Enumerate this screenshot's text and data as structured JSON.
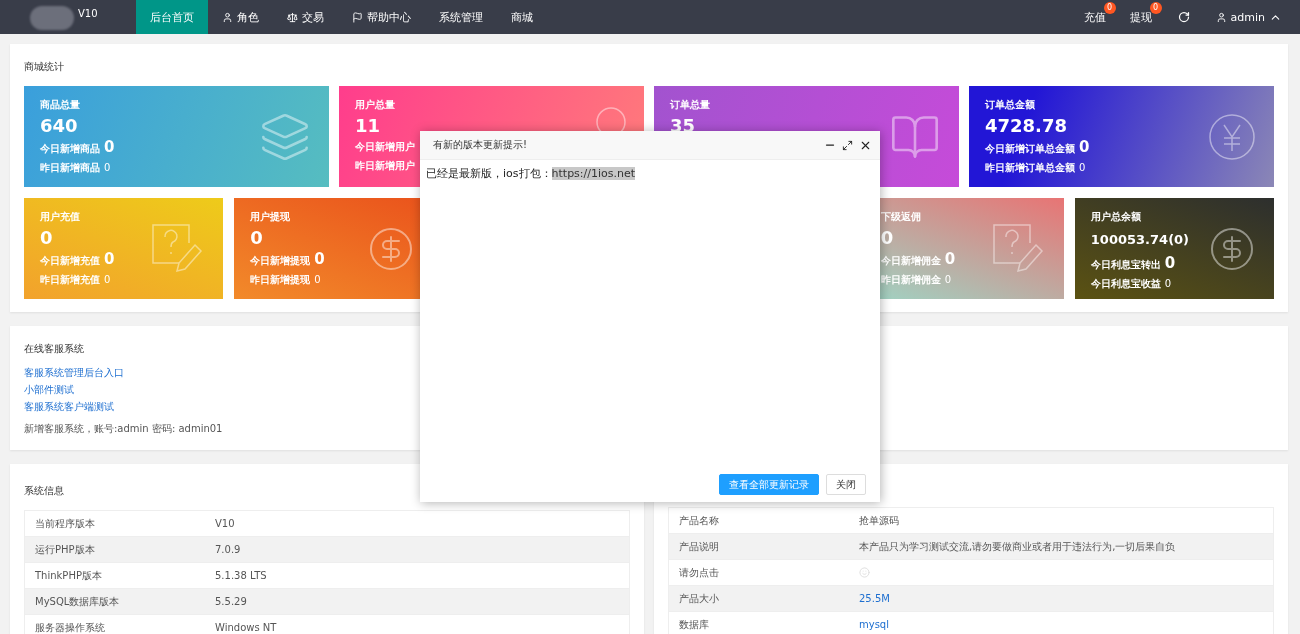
{
  "nav": {
    "version": "V10",
    "items": [
      {
        "label": "后台首页",
        "selected": true
      },
      {
        "label": "角色",
        "selected": false
      },
      {
        "label": "交易",
        "selected": false
      },
      {
        "label": "帮助中心",
        "selected": false
      },
      {
        "label": "系统管理",
        "selected": false
      },
      {
        "label": "商城",
        "selected": false
      }
    ],
    "right": [
      {
        "kind": "badge",
        "label": "充值",
        "count": "0"
      },
      {
        "kind": "badge",
        "label": "提现",
        "count": "0"
      },
      {
        "kind": "refresh"
      },
      {
        "kind": "user",
        "label": "admin"
      }
    ]
  },
  "stats": {
    "title": "商城统计",
    "rows": [
      [
        {
          "title": "商品总量",
          "value": "640",
          "lines": [
            {
              "label": "今日新增商品",
              "value": "0"
            },
            {
              "label": "昨日新增商品",
              "value": "0"
            }
          ]
        },
        {
          "title": "用户总量",
          "value": "11",
          "lines": [
            {
              "label": "今日新增用户"
            },
            {
              "label": "昨日新增用户"
            }
          ]
        },
        {
          "title": "订单总量",
          "value": "35"
        },
        {
          "title": "订单总金额",
          "value": "4728.78",
          "lines": [
            {
              "label": "今日新增订单总金额",
              "value": "0"
            },
            {
              "label": "昨日新增订单总金额",
              "value": "0"
            }
          ]
        }
      ],
      [
        {
          "title": "用户充值",
          "value": "0",
          "lines": [
            {
              "label": "今日新增充值",
              "value": "0"
            },
            {
              "label": "昨日新增充值",
              "value": "0"
            }
          ]
        },
        {
          "title": "用户提现",
          "value": "0",
          "lines": [
            {
              "label": "今日新增提现",
              "value": "0"
            },
            {
              "label": "昨日新增提现",
              "value": "0"
            }
          ]
        },
        {
          "title": "下级返佣",
          "value": "0",
          "lines": [
            {
              "label": "今日新增佣金",
              "value": "0"
            },
            {
              "label": "昨日新增佣金",
              "value": "0"
            }
          ]
        },
        {
          "title": "用户总余额",
          "value": "100053.74(0)",
          "lines": [
            {
              "label": "今日利息宝转出",
              "value": "0"
            },
            {
              "label": "今日利息宝收益",
              "value": "0"
            }
          ]
        }
      ]
    ]
  },
  "service": {
    "title": "在线客服系统",
    "links": [
      "客服系统管理后台入口",
      "小部件测试",
      "客服系统客户端测试"
    ],
    "note": "新增客服系统，账号:admin 密码: admin01"
  },
  "system_info": {
    "title": "系统信息",
    "rows": [
      {
        "label": "当前程序版本",
        "value": "V10"
      },
      {
        "label": "运行PHP版本",
        "value": "7.0.9"
      },
      {
        "label": "ThinkPHP版本",
        "value": "5.1.38 LTS"
      },
      {
        "label": "MySQL数据库版本",
        "value": "5.5.29"
      },
      {
        "label": "服务器操作系统",
        "value": "Windows NT"
      }
    ]
  },
  "product_info": {
    "rows": [
      {
        "label": "产品名称",
        "kind": "text",
        "value": "抢单源码"
      },
      {
        "label": "产品说明",
        "kind": "text",
        "value": "本产品只为学习测试交流,请勿要做商业或者用于违法行为,一切后果自负"
      },
      {
        "label": "请勿点击",
        "kind": "icon"
      },
      {
        "label": "产品大小",
        "kind": "link",
        "value": "25.5M"
      },
      {
        "label": "数据库",
        "kind": "link",
        "value": "mysql"
      }
    ]
  },
  "dialog": {
    "title": "有新的版本更新提示!",
    "message": "已经是最新版，ios打包：",
    "url": "https://1ios.net",
    "buttons": [
      {
        "kind": "primary",
        "label": "查看全部更新记录"
      },
      {
        "kind": "plain",
        "label": "关闭"
      }
    ]
  }
}
